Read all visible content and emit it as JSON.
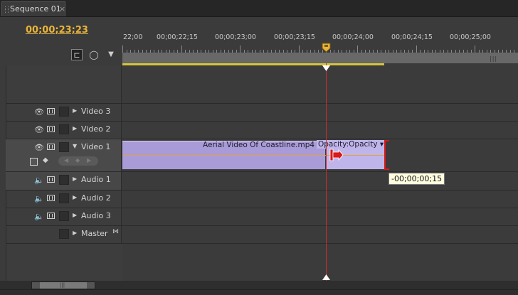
{
  "tab": {
    "title": "Sequence 01",
    "close": "×"
  },
  "timecode": "00;00;23;23",
  "controls": {
    "snap_icon": "snap-icon",
    "marker_icon": "marker-icon",
    "keyframe_icon": "keyframe-icon"
  },
  "ruler": {
    "labels": [
      "22;00",
      "00;00;22;15",
      "00;00;23;00",
      "00;00;23;15",
      "00;00;24;00",
      "00;00;24;15",
      "00;00;25;00"
    ]
  },
  "tracks": {
    "video3": "Video 3",
    "video2": "Video 2",
    "video1": "Video 1",
    "audio1": "Audio 1",
    "audio2": "Audio 2",
    "audio3": "Audio 3",
    "master": "Master"
  },
  "clip": {
    "name": "Aerial Video Of Coastline.mp4",
    "effect": "Opacity:Opacity ▾",
    "color": "#a99bd7"
  },
  "tooltip": "-00;00;00;15",
  "colors": {
    "timecode": "#e8b33a",
    "playhead": "#c9302c",
    "in_out": "#d6c43a",
    "trim": "#d61b1b"
  }
}
